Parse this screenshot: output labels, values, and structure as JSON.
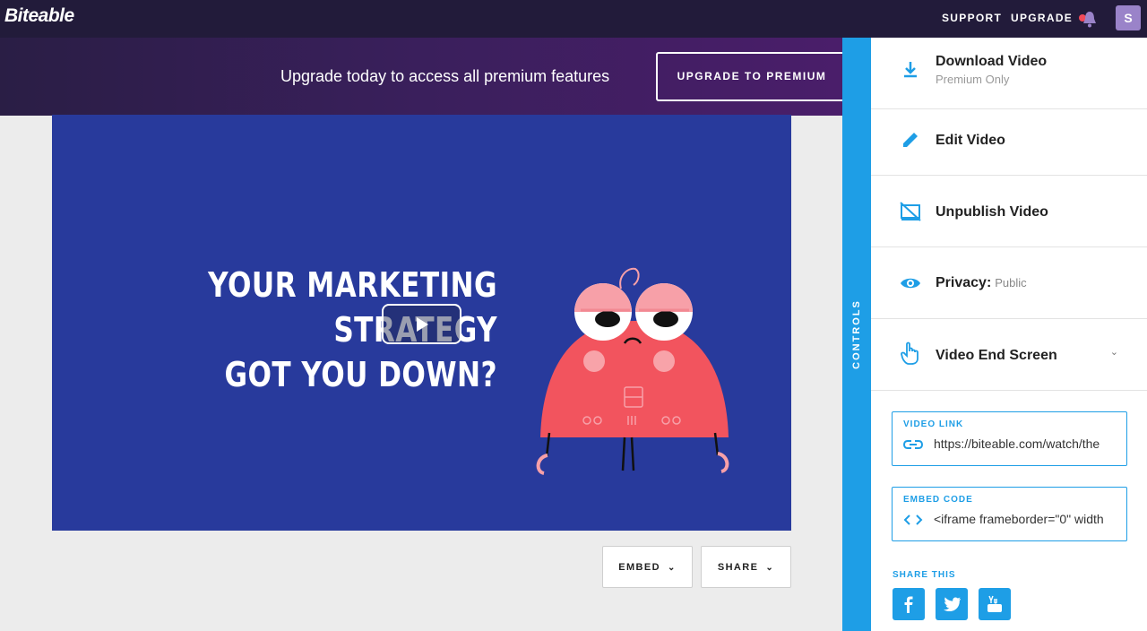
{
  "app": {
    "logo": "Biteable"
  },
  "nav": {
    "support": "SUPPORT",
    "upgrade": "UPGRADE",
    "avatar_initial": "S"
  },
  "banner": {
    "text": "Upgrade today to access all premium features",
    "button": "UPGRADE TO PREMIUM"
  },
  "video": {
    "headline_line1": "YOUR MARKETING STRATEGY",
    "headline_line2": "GOT YOU DOWN?",
    "background_color": "#283a9c"
  },
  "actions": {
    "embed": "EMBED",
    "share": "SHARE"
  },
  "controls": {
    "tab_label": "CONTROLS",
    "items": [
      {
        "title": "Download Video",
        "subtitle": "Premium Only",
        "icon": "download-icon"
      },
      {
        "title": "Edit Video",
        "icon": "pencil-icon"
      },
      {
        "title": "Unpublish Video",
        "icon": "unpublish-icon"
      },
      {
        "title": "Privacy:",
        "value": "Public",
        "icon": "eye-icon"
      },
      {
        "title": "Video End Screen",
        "icon": "pointer-hand-icon"
      }
    ],
    "video_link": {
      "label": "VIDEO LINK",
      "value": "https://biteable.com/watch/the"
    },
    "embed_code": {
      "label": "EMBED CODE",
      "value": "<iframe frameborder=\"0\" width"
    },
    "share_label": "SHARE THIS",
    "social": [
      "facebook-icon",
      "twitter-icon",
      "youtube-icon"
    ]
  },
  "colors": {
    "accent": "#1e9ee6",
    "topbar": "#221b3a",
    "monster": "#f2545e"
  }
}
